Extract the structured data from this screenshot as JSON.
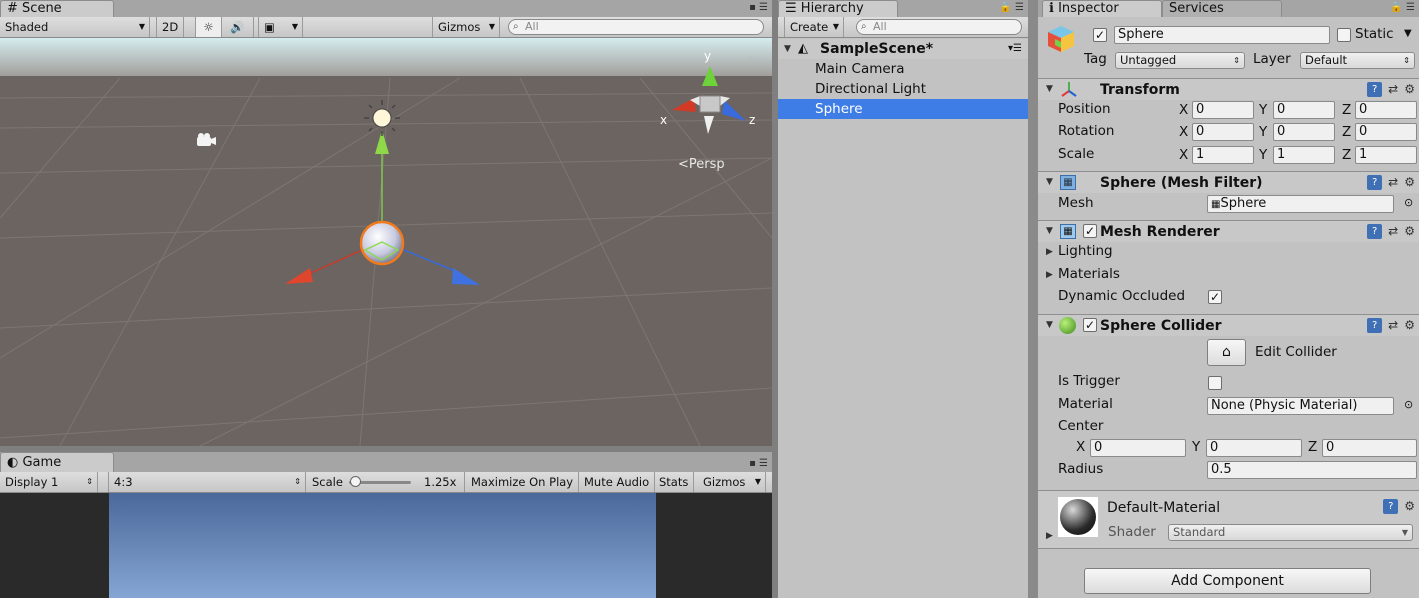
{
  "scene": {
    "tab": "Scene",
    "shading": "Shaded",
    "mode_2d": "2D",
    "gizmos": "Gizmos",
    "search_placeholder": "All",
    "persp": "Persp",
    "axis_x": "x",
    "axis_y": "y",
    "axis_z": "z",
    "sky_color": "#cfe3e6",
    "ground_color": "#6b6460"
  },
  "game": {
    "tab": "Game",
    "display": "Display 1",
    "aspect": "4:3",
    "scale_label": "Scale",
    "scale_value": "1.25x",
    "maximize": "Maximize On Play",
    "mute": "Mute Audio",
    "stats": "Stats",
    "gizmos": "Gizmos"
  },
  "hierarchy": {
    "tab": "Hierarchy",
    "create": "Create",
    "search_placeholder": "All",
    "scene_name": "SampleScene*",
    "items": [
      "Main Camera",
      "Directional Light",
      "Sphere"
    ]
  },
  "inspector": {
    "tab": "Inspector",
    "tab2": "Services",
    "object_name": "Sphere",
    "static_label": "Static",
    "tag_label": "Tag",
    "tag_value": "Untagged",
    "layer_label": "Layer",
    "layer_value": "Default",
    "transform": {
      "title": "Transform",
      "position": "Position",
      "rotation": "Rotation",
      "scale": "Scale",
      "x": "X",
      "y": "Y",
      "z": "Z",
      "pos": [
        "0",
        "0",
        "0"
      ],
      "rot": [
        "0",
        "0",
        "0"
      ],
      "scl": [
        "1",
        "1",
        "1"
      ]
    },
    "mesh_filter": {
      "title": "Sphere (Mesh Filter)",
      "mesh_label": "Mesh",
      "mesh_value": "Sphere"
    },
    "mesh_renderer": {
      "title": "Mesh Renderer",
      "lighting": "Lighting",
      "materials": "Materials",
      "dynamic": "Dynamic Occluded"
    },
    "collider": {
      "title": "Sphere Collider",
      "edit": "Edit Collider",
      "trigger": "Is Trigger",
      "material_label": "Material",
      "material_value": "None (Physic Material)",
      "center": "Center",
      "cx": "0",
      "cy": "0",
      "cz": "0",
      "radius_label": "Radius",
      "radius": "0.5"
    },
    "material": {
      "name": "Default-Material",
      "shader_label": "Shader",
      "shader_value": "Standard"
    },
    "add_component": "Add Component"
  }
}
